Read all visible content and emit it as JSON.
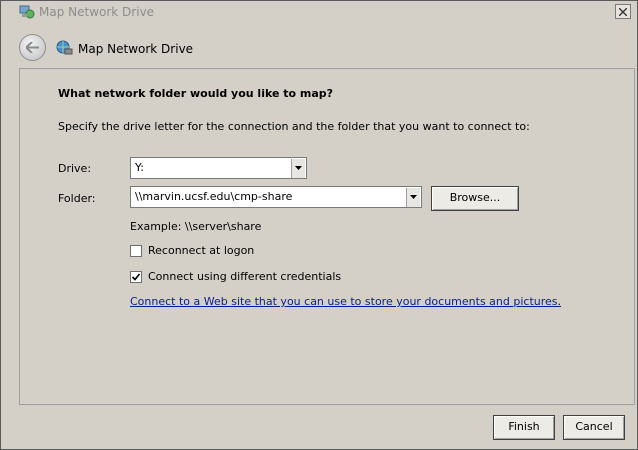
{
  "window": {
    "title": "Map Network Drive"
  },
  "header": {
    "title": "Map Network Drive"
  },
  "content": {
    "question": "What network folder would you like to map?",
    "instructions": "Specify the drive letter for the connection and the folder that you want to connect to:",
    "drive": {
      "label": "Drive:",
      "value": "Y:"
    },
    "folder": {
      "label": "Folder:",
      "value": "\\\\marvin.ucsf.edu\\cmp-share",
      "browse_label": "Browse..."
    },
    "example": "Example: \\\\server\\share",
    "reconnect": {
      "label": "Reconnect at logon",
      "checked": false
    },
    "credentials": {
      "label": "Connect using different credentials",
      "checked": true
    },
    "link_text": "Connect to a Web site that you can use to store your documents and pictures",
    "link_suffix": "."
  },
  "footer": {
    "finish_label": "Finish",
    "cancel_label": "Cancel"
  },
  "icons": [
    "network-drive-icon",
    "close-icon",
    "back-arrow-icon",
    "chevron-down-icon",
    "checkmark-icon"
  ]
}
